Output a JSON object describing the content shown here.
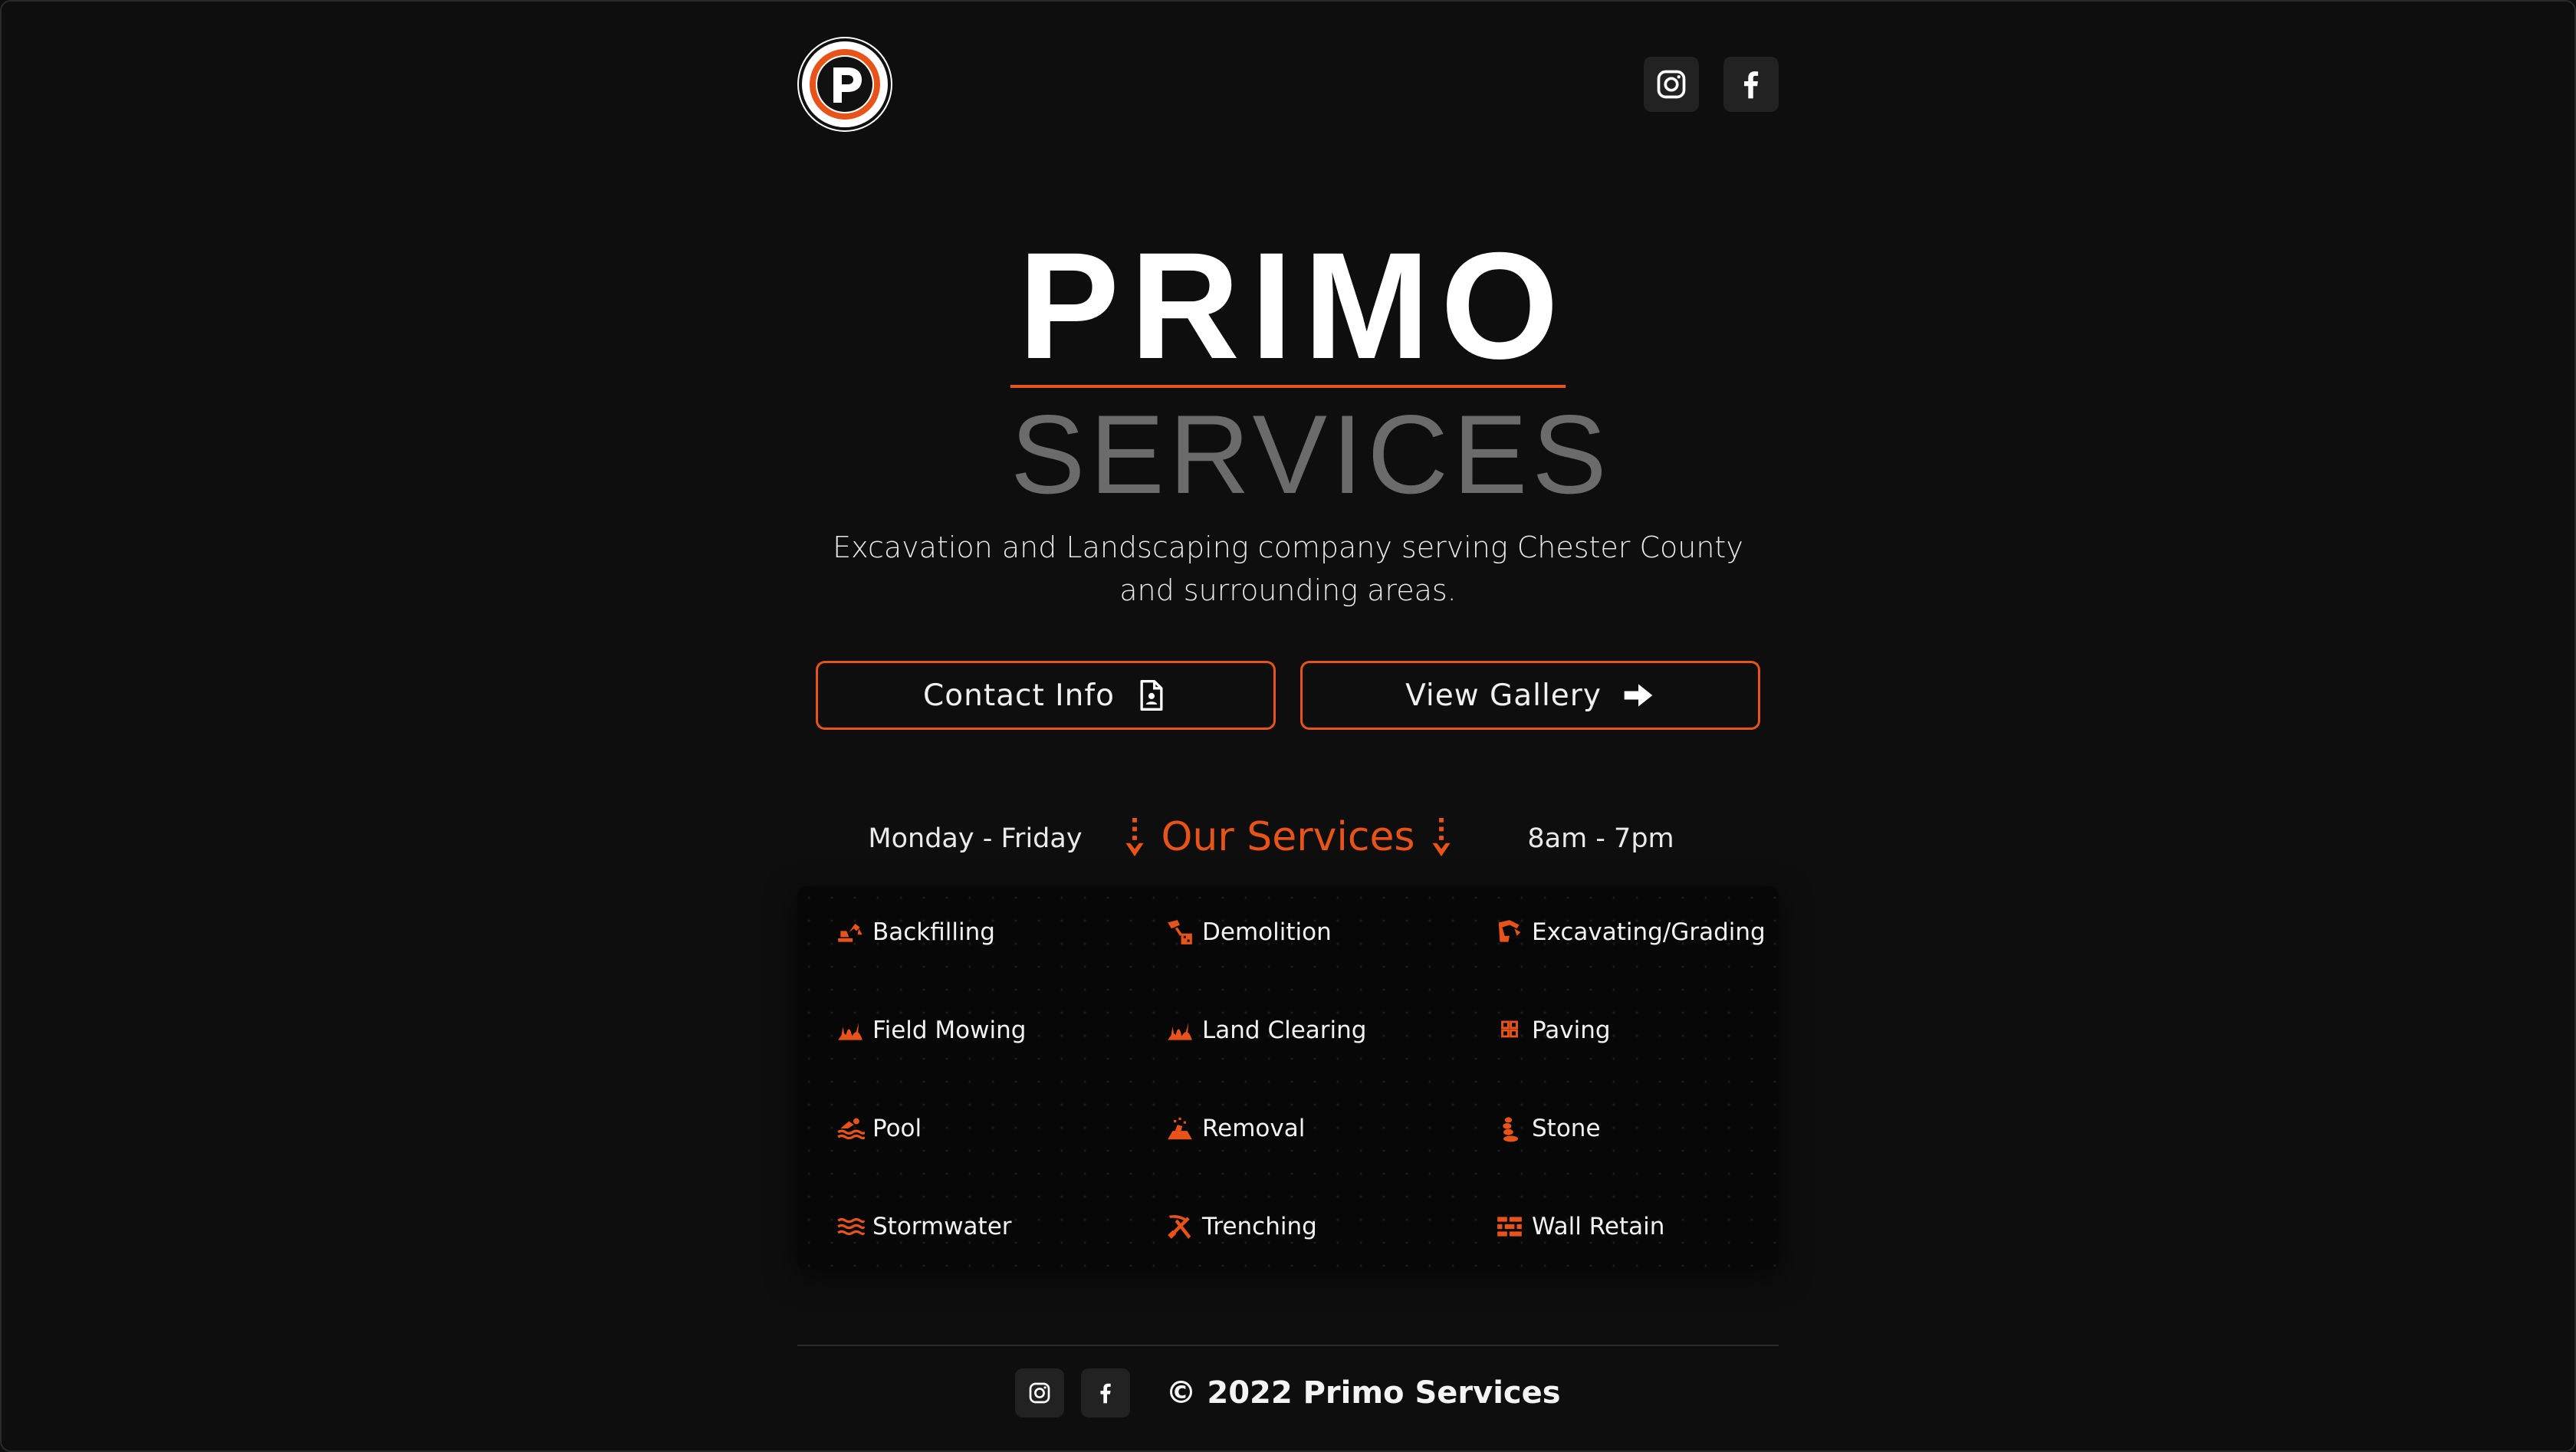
{
  "header": {
    "logo_letter": "P",
    "social": [
      {
        "icon": "instagram-icon"
      },
      {
        "icon": "facebook-icon"
      }
    ]
  },
  "hero": {
    "title": "PRIMO",
    "subtitle": "SERVICES",
    "tagline": "Excavation and Landscaping company serving Chester County and surrounding areas."
  },
  "buttons": {
    "contact_label": "Contact Info",
    "contact_icon": "contact-card-icon",
    "gallery_label": "View Gallery",
    "gallery_icon": "arrow-right-icon"
  },
  "services": {
    "days": "Monday - Friday",
    "heading": "Our Services",
    "hours": "8am - 7pm",
    "heading_icon": "arrow-down-icon",
    "items": [
      {
        "label": "Backfilling",
        "icon": "excavator-icon"
      },
      {
        "label": "Demolition",
        "icon": "demolition-icon"
      },
      {
        "label": "Excavating/Grading",
        "icon": "digger-arm-icon"
      },
      {
        "label": "Field Mowing",
        "icon": "grass-icon"
      },
      {
        "label": "Land Clearing",
        "icon": "grass-icon"
      },
      {
        "label": "Paving",
        "icon": "paving-tiles-icon"
      },
      {
        "label": "Pool",
        "icon": "swimmer-icon"
      },
      {
        "label": "Removal",
        "icon": "debris-icon"
      },
      {
        "label": "Stone",
        "icon": "stones-icon"
      },
      {
        "label": "Stormwater",
        "icon": "water-waves-icon"
      },
      {
        "label": "Trenching",
        "icon": "pickaxe-shovel-icon"
      },
      {
        "label": "Wall Retain",
        "icon": "brick-wall-icon"
      }
    ]
  },
  "footer": {
    "copyright": "© 2022 Primo Services"
  },
  "colors": {
    "accent": "#e8531a",
    "background": "#0e0e0e",
    "muted": "#6b6b6b"
  }
}
